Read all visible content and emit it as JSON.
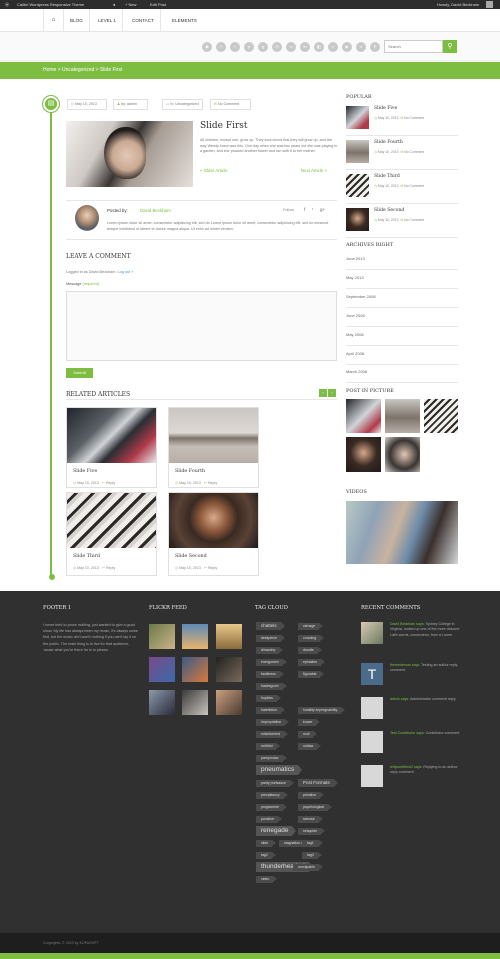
{
  "adminbar": {
    "site": "Calibri Wordpress Responsive Theme",
    "new": "+ New",
    "edit": "Edit Post",
    "howdy": "Howdy, David Beckham"
  },
  "nav": {
    "items": [
      "BLOG",
      "LEVEL 1",
      "CONTACT",
      "ELEMENTS"
    ]
  },
  "search": {
    "placeholder": "Search"
  },
  "breadcrumb": "Home > Uncategorized > Slide First",
  "post": {
    "date": "May 10, 2013",
    "author": "by: admin",
    "category": "In: Uncategorized",
    "comments": "No Comment",
    "title": "Slide First",
    "excerpt": "All children, except one, grow up. They soon know that they will grow up, and the way Wendy knew was this. One day when she was two years old she was playing in a garden, and she plucked another flower and ran with it to her mother.",
    "older": "« Older Article",
    "newer": "Next Article »"
  },
  "author_box": {
    "posted_by": "Posted by:",
    "name": "David Beckham",
    "follow": "Follow",
    "bio": "Lorem ipsum dolor sit amet, consectetur adipisicing elit, sed do Lorem ipsum dolor sit amet, consectetur adipisicing elit, sed do eiusmod tempor incididunt ut labore et dolore magna aliqua. Ut enim ad minim veniam."
  },
  "comment_form": {
    "heading": "LEAVE A COMMENT",
    "logged_in": "Logged in as David Beckham.",
    "logout": "Log out »",
    "message_label": "Message",
    "required": "(required)",
    "submit": "Submit"
  },
  "related": {
    "heading": "RELATED ARTICLES",
    "items": [
      {
        "title": "Slide Five",
        "date": "May 10, 2013",
        "reply": "Reply"
      },
      {
        "title": "Slide Fourth",
        "date": "May 10, 2013",
        "reply": "Reply"
      },
      {
        "title": "Slide Third",
        "date": "May 10, 2013",
        "reply": "Reply"
      },
      {
        "title": "Slide Second",
        "date": "May 10, 2013",
        "reply": "Reply"
      }
    ]
  },
  "sidebar": {
    "popular_heading": "POPULAR",
    "popular": [
      {
        "title": "Slide Five",
        "date": "May 10, 2013",
        "comments": "No Comment"
      },
      {
        "title": "Slide Fourth",
        "date": "May 10, 2013",
        "comments": "No Comment"
      },
      {
        "title": "Slide Third",
        "date": "May 10, 2013",
        "comments": "No Comment"
      },
      {
        "title": "Slide Second",
        "date": "May 10, 2013",
        "comments": "No Comment"
      }
    ],
    "archives_heading": "ARCHIVES RIGHT",
    "archives": [
      "June 2013",
      "May 2013",
      "September 2008",
      "June 2008",
      "May 2008",
      "April 2008",
      "March 2008"
    ],
    "pictures_heading": "POST IN PICTURE",
    "videos_heading": "VIDEOS"
  },
  "footer": {
    "col1_heading": "FOOTER 1",
    "col1_text": "I never tried to prove nothing, just wanted to give a good show. My life has always been my music, it's always come first, but the music ain't worth nothing if you can't lay it on the public. The main thing is to live for that audience, 'cause what you're there for is to please.",
    "flickr_heading": "FLICKR FEED",
    "tags_heading": "TAG CLOUD",
    "tags": [
      "chattels",
      "cienage",
      "deskpiece",
      "crushing",
      "dimarchy",
      "doodle",
      "energumen",
      "ephialtes",
      "faultiness",
      "figurable",
      "hadesgrom",
      "hopkiss",
      "hatefiction",
      "hostility impregnability",
      "impropriation",
      "knave",
      "misinformed",
      "moil",
      "mirthful",
      "outlaw",
      "pamprodac",
      "pneumatics",
      "parity portsaave",
      "Post Formats",
      "precipitancy",
      "privation",
      "programme",
      "psychological",
      "punisher",
      "ramose",
      "renegade",
      "sesquide",
      "slide",
      "stagnation unmisled",
      "tag1",
      "tag2",
      "tag3",
      "thunderheaded",
      "unculpable",
      "video",
      "withered brandnew",
      "xanthopsia"
    ],
    "comments_heading": "RECENT COMMENTS",
    "comments": [
      {
        "author": "David Beckham says:",
        "text": "Sydney College in Virginia, looked up one of the more obscure Latin words, consectetur, from a Lorem"
      },
      {
        "author": "themedemos says:",
        "text": "Testing an author reply comment."
      },
      {
        "author": "admin says:",
        "text": "Administrator comment reply."
      },
      {
        "author": "Test Contributor says:",
        "text": "Contributor comment"
      },
      {
        "author": "tellyworthtest2 says:",
        "text": "Replying to an author reply comment."
      }
    ]
  },
  "copyright": "Copyrights, © 2013 by KOPASOFT",
  "colors": {
    "accent": "#7cbd42",
    "footer_bg": "#303030",
    "adminbar": "#2d2d2d"
  }
}
